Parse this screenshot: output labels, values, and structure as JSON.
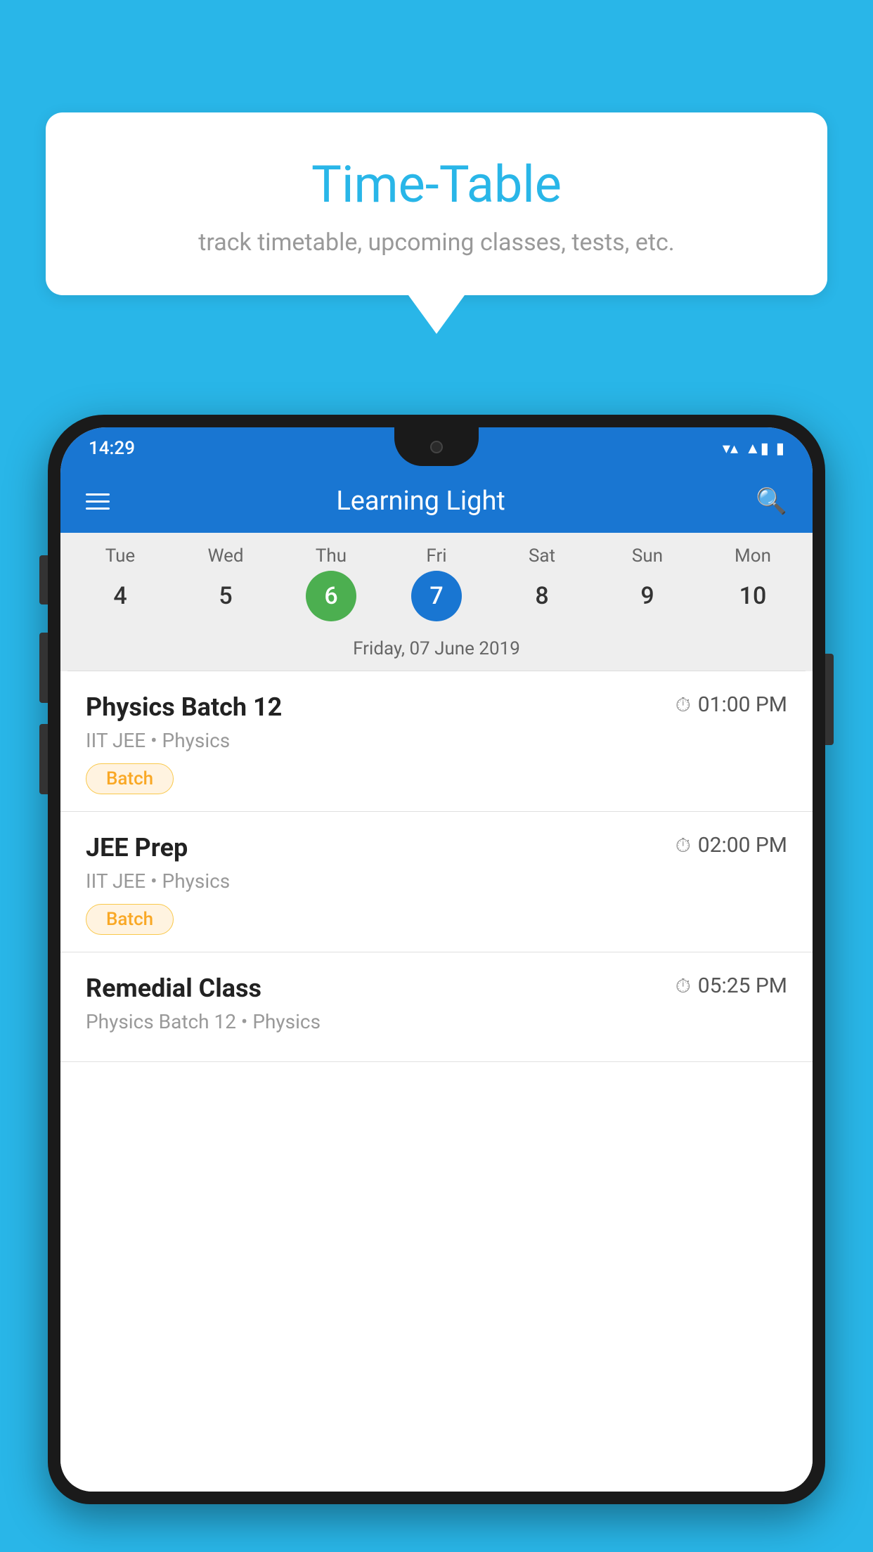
{
  "background_color": "#29b6e8",
  "bubble": {
    "title": "Time-Table",
    "subtitle": "track timetable, upcoming classes, tests, etc."
  },
  "phone": {
    "status_bar": {
      "time": "14:29",
      "wifi": "▼▲",
      "battery": "▮"
    },
    "header": {
      "title": "Learning Light",
      "menu_label": "Menu",
      "search_label": "Search"
    },
    "calendar": {
      "days": [
        {
          "name": "Tue",
          "num": "4",
          "state": "normal"
        },
        {
          "name": "Wed",
          "num": "5",
          "state": "normal"
        },
        {
          "name": "Thu",
          "num": "6",
          "state": "today"
        },
        {
          "name": "Fri",
          "num": "7",
          "state": "selected"
        },
        {
          "name": "Sat",
          "num": "8",
          "state": "normal"
        },
        {
          "name": "Sun",
          "num": "9",
          "state": "normal"
        },
        {
          "name": "Mon",
          "num": "10",
          "state": "normal"
        }
      ],
      "selected_date": "Friday, 07 June 2019"
    },
    "classes": [
      {
        "name": "Physics Batch 12",
        "time": "01:00 PM",
        "meta": "IIT JEE • Physics",
        "badge": "Batch"
      },
      {
        "name": "JEE Prep",
        "time": "02:00 PM",
        "meta": "IIT JEE • Physics",
        "badge": "Batch"
      },
      {
        "name": "Remedial Class",
        "time": "05:25 PM",
        "meta": "Physics Batch 12 • Physics",
        "badge": ""
      }
    ]
  }
}
